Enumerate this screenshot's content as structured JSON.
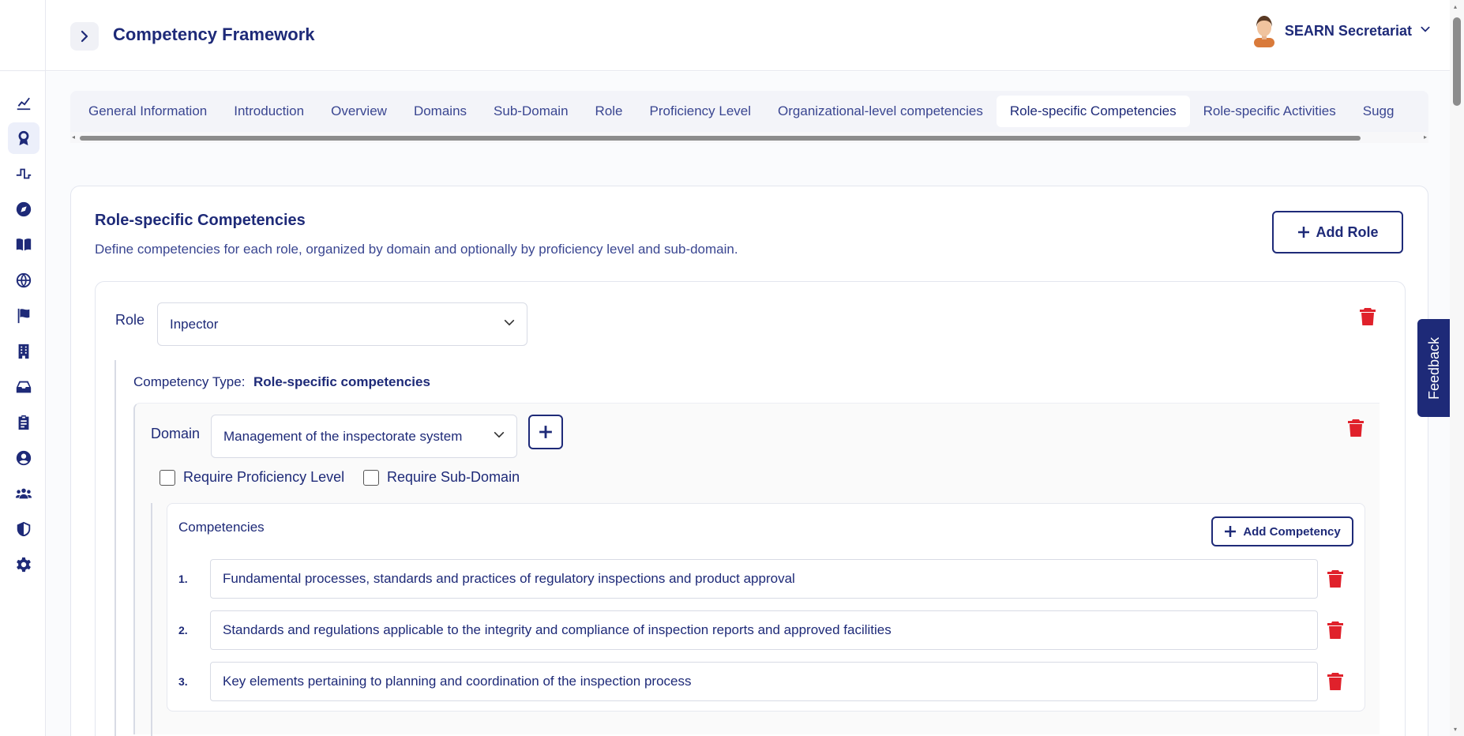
{
  "header": {
    "title": "Competency Framework",
    "user_name": "SEARN Secretariat"
  },
  "sidebar": {
    "items": [
      {
        "icon": "chart-line-icon"
      },
      {
        "icon": "award-icon",
        "active": true
      },
      {
        "icon": "pulse-icon"
      },
      {
        "icon": "compass-icon"
      },
      {
        "icon": "book-icon"
      },
      {
        "icon": "globe-icon"
      },
      {
        "icon": "flag-icon"
      },
      {
        "icon": "building-icon"
      },
      {
        "icon": "inbox-icon"
      },
      {
        "icon": "clipboard-icon"
      },
      {
        "icon": "user-circle-icon"
      },
      {
        "icon": "users-icon"
      },
      {
        "icon": "shield-icon"
      },
      {
        "icon": "gear-icon"
      }
    ]
  },
  "tabs": [
    {
      "label": "General Information"
    },
    {
      "label": "Introduction"
    },
    {
      "label": "Overview"
    },
    {
      "label": "Domains"
    },
    {
      "label": "Sub-Domain"
    },
    {
      "label": "Role"
    },
    {
      "label": "Proficiency Level"
    },
    {
      "label": "Organizational-level competencies"
    },
    {
      "label": "Role-specific Competencies",
      "active": true
    },
    {
      "label": "Role-specific Activities"
    },
    {
      "label": "Sugg"
    }
  ],
  "section": {
    "title": "Role-specific Competencies",
    "description": "Define competencies for each role, organized by domain and optionally by proficiency level and sub-domain.",
    "add_role_label": "Add Role"
  },
  "role": {
    "label": "Role",
    "selected": "Inpector",
    "competency_type_label": "Competency Type:",
    "competency_type_value": "Role-specific competencies"
  },
  "domain": {
    "label": "Domain",
    "selected": "Management of the inspectorate system",
    "require_proficiency_label": "Require Proficiency Level",
    "require_subdomain_label": "Require Sub-Domain"
  },
  "competencies": {
    "title": "Competencies",
    "add_label": "Add Competency",
    "items": [
      {
        "num": "1.",
        "value": "Fundamental processes, standards and practices of regulatory inspections and product approval"
      },
      {
        "num": "2.",
        "value": "Standards and regulations applicable to the integrity and compliance of inspection reports and approved facilities"
      },
      {
        "num": "3.",
        "value": "Key elements pertaining to planning and coordination of the inspection process"
      }
    ]
  },
  "feedback_label": "Feedback",
  "colors": {
    "primary": "#1e2a78",
    "danger": "#e0212b",
    "border": "#d8dbe5"
  }
}
